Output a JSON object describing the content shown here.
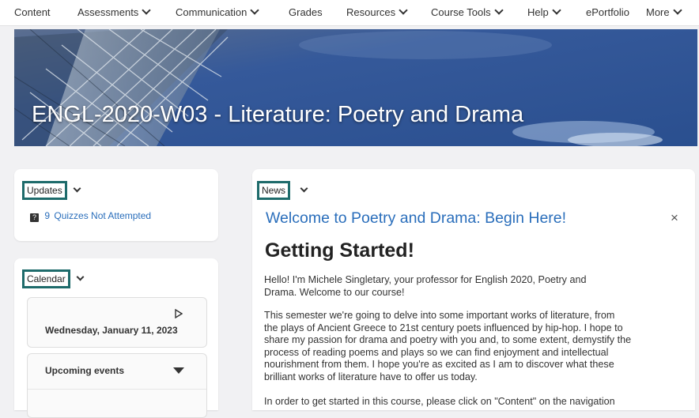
{
  "nav": {
    "items": [
      {
        "label": "Content",
        "has_menu": false
      },
      {
        "label": "Assessments",
        "has_menu": true
      },
      {
        "label": "Communication",
        "has_menu": true
      },
      {
        "label": "Grades",
        "has_menu": false
      },
      {
        "label": "Resources",
        "has_menu": true
      },
      {
        "label": "Course Tools",
        "has_menu": true
      },
      {
        "label": "Help",
        "has_menu": true
      },
      {
        "label": "ePortfolio",
        "has_menu": false
      },
      {
        "label": "More",
        "has_menu": true
      }
    ]
  },
  "banner": {
    "title": "ENGL-2020-W03 - Literature: Poetry and Drama"
  },
  "updates": {
    "heading": "Updates",
    "count": "9",
    "item_text": "Quizzes Not Attempted"
  },
  "calendar": {
    "heading": "Calendar",
    "date": "Wednesday, January 11, 2023",
    "upcoming_label": "Upcoming events"
  },
  "news": {
    "heading": "News",
    "post_title": "Welcome to Poetry and Drama: Begin Here!",
    "close_glyph": "×",
    "subheading": "Getting Started!",
    "paragraph1_line1": "Hello! I'm Michele Singletary, your professor for English 2020, Poetry and",
    "paragraph1_line2": "Drama. Welcome to our course!",
    "paragraph2_line1": "This semester we're going to delve into some important works of literature, from",
    "paragraph2_line2": "the plays of Ancient Greece to 21st century poets influenced by hip-hop. I hope to",
    "paragraph2_line3": "share my passion for drama and poetry with you and, to some extent, demystify the",
    "paragraph2_line4": "process of reading poems and plays so we can find enjoyment and intellectual",
    "paragraph2_line5": "nourishment from them. I hope you're as excited as I am to discover what these",
    "paragraph2_line6": "brilliant works of literature have to offer us today.",
    "paragraph3_line1": "In order to get started in this course, please click on \"Content\" on the navigation"
  },
  "colors": {
    "accent_outline": "#1e6b6b",
    "link": "#2a6ebb"
  }
}
